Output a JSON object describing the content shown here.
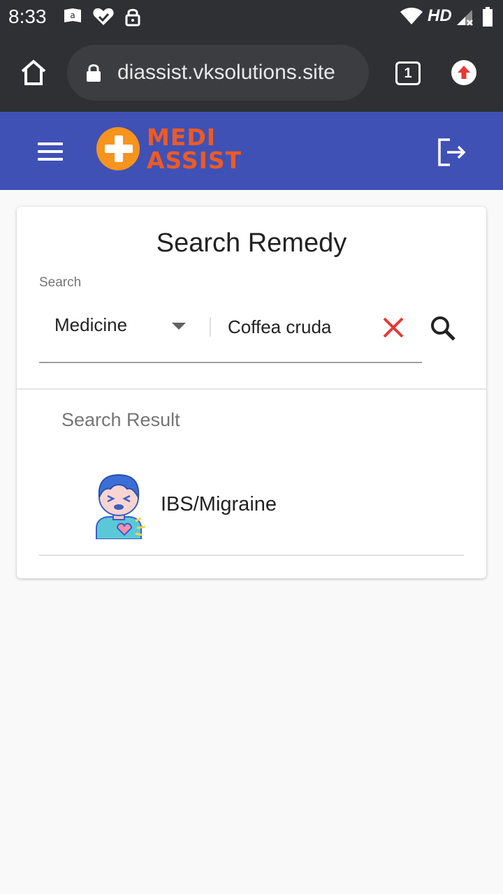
{
  "status_bar": {
    "time": "8:33",
    "network_label": "HD",
    "icons": [
      "amazon-icon",
      "heart-check-icon",
      "lock-icon",
      "wifi-icon",
      "signal-icon",
      "battery-icon"
    ]
  },
  "browser": {
    "url": "diassist.vksolutions.site",
    "tab_count": "1",
    "icons": [
      "home-icon",
      "lock-icon",
      "upload-icon"
    ]
  },
  "app_header": {
    "logo_line1": "MEDI",
    "logo_line2": "ASSIST",
    "icons": [
      "hamburger-icon",
      "logout-icon"
    ],
    "colors": {
      "header_bg": "#3f51b5",
      "logo_orange": "#f7941d",
      "logo_text": "#ef5a24"
    }
  },
  "search_card": {
    "title": "Search Remedy",
    "search_label": "Search",
    "search_type": "Medicine",
    "query": "Coffea cruda",
    "icons": [
      "chevron-down-icon",
      "clear-icon",
      "search-icon"
    ],
    "colors": {
      "clear": "#e53935"
    }
  },
  "results": {
    "heading": "Search Result",
    "items": [
      {
        "label": "IBS/Migraine",
        "icon": "sick-person-icon"
      }
    ]
  }
}
